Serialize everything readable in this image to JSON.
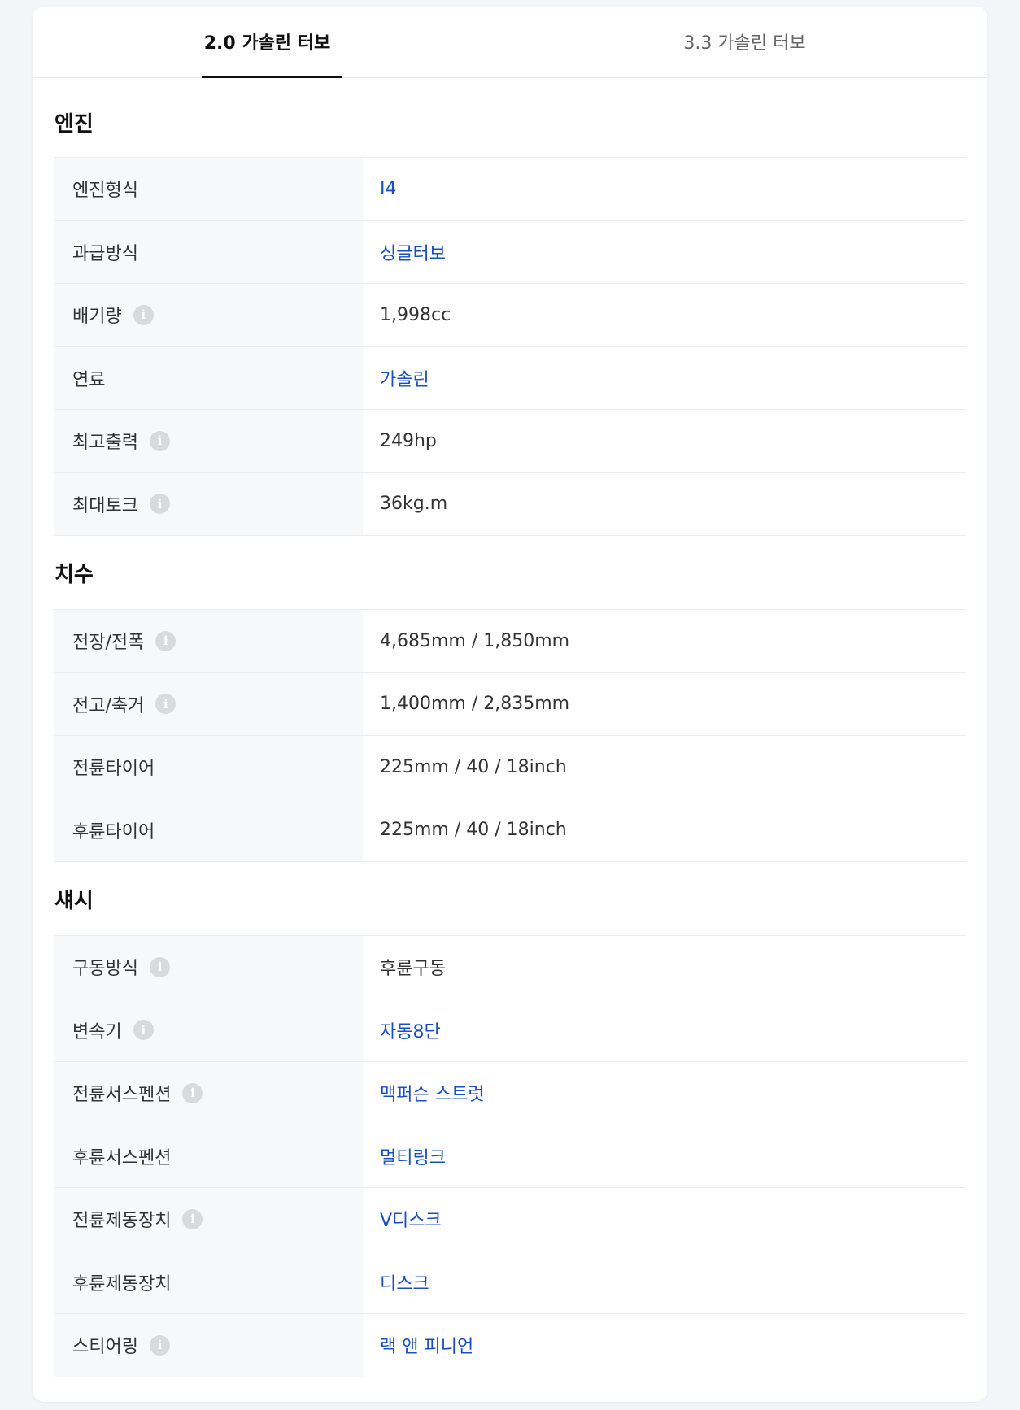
{
  "tabs": [
    {
      "label": "2.0 가솔린 터보",
      "active": true
    },
    {
      "label": "3.3 가솔린 터보",
      "active": false
    }
  ],
  "info_icon_glyph": "i",
  "colors": {
    "link": "#1a4fc4",
    "label_bg": "#f7f8fa",
    "info_icon": "#d9dadd"
  },
  "sections": [
    {
      "title": "엔진",
      "rows": [
        {
          "label": "엔진형식",
          "value": "I4",
          "info": false,
          "link": true
        },
        {
          "label": "과급방식",
          "value": "싱글터보",
          "info": false,
          "link": true
        },
        {
          "label": "배기량",
          "value": "1,998cc",
          "info": true,
          "link": false
        },
        {
          "label": "연료",
          "value": "가솔린",
          "info": false,
          "link": true
        },
        {
          "label": "최고출력",
          "value": "249hp",
          "info": true,
          "link": false
        },
        {
          "label": "최대토크",
          "value": "36kg.m",
          "info": true,
          "link": false
        }
      ]
    },
    {
      "title": "치수",
      "rows": [
        {
          "label": "전장/전폭",
          "value": "4,685mm / 1,850mm",
          "info": true,
          "link": false
        },
        {
          "label": "전고/축거",
          "value": "1,400mm / 2,835mm",
          "info": true,
          "link": false
        },
        {
          "label": "전륜타이어",
          "value": "225mm / 40 / 18inch",
          "info": false,
          "link": false
        },
        {
          "label": "후륜타이어",
          "value": "225mm / 40 / 18inch",
          "info": false,
          "link": false
        }
      ]
    },
    {
      "title": "섀시",
      "rows": [
        {
          "label": "구동방식",
          "value": "후륜구동",
          "info": true,
          "link": false
        },
        {
          "label": "변속기",
          "value": "자동8단",
          "info": true,
          "link": true
        },
        {
          "label": "전륜서스펜션",
          "value": "맥퍼슨 스트럿",
          "info": true,
          "link": true
        },
        {
          "label": "후륜서스펜션",
          "value": "멀티링크",
          "info": false,
          "link": true
        },
        {
          "label": "전륜제동장치",
          "value": "V디스크",
          "info": true,
          "link": true
        },
        {
          "label": "후륜제동장치",
          "value": "디스크",
          "info": false,
          "link": true
        },
        {
          "label": "스티어링",
          "value": "랙 앤 피니언",
          "info": true,
          "link": true
        }
      ]
    }
  ]
}
